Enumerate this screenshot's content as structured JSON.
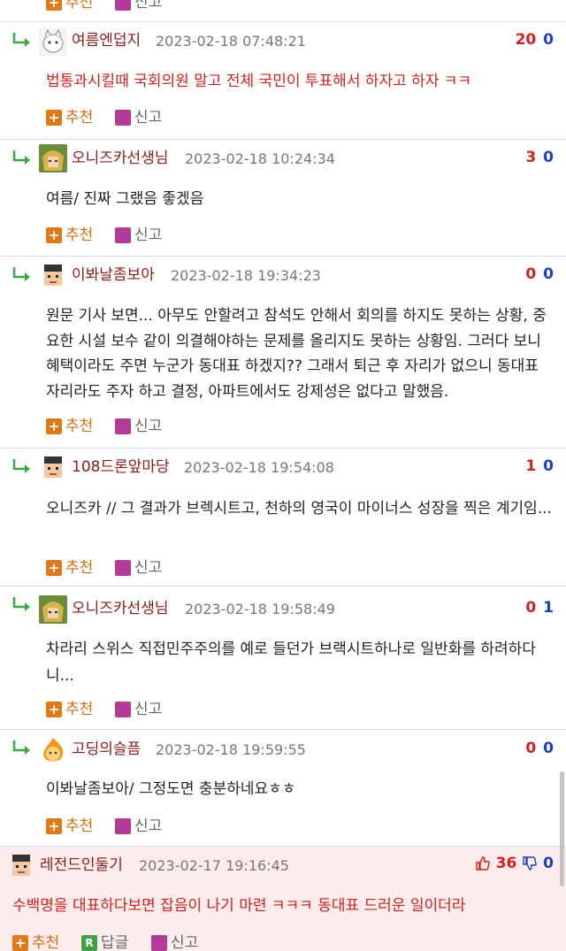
{
  "actions": {
    "recommend": "추천",
    "report": "신고",
    "reply": "답글"
  },
  "top_partial": {
    "recommend": "추천",
    "report": "신고"
  },
  "comments": [
    {
      "nick": "여름엔덥지",
      "date": "2023-02-18 07:48:21",
      "up": "20",
      "down": "0",
      "text": "법통과시킬때 국회의원 말고 전체 국민이 투표해서 하자고 하자 ㅋㅋ",
      "avatar": "cat-avatar"
    },
    {
      "nick": "오니즈카선생님",
      "date": "2023-02-18 10:24:34",
      "up": "3",
      "down": "0",
      "text": "여름/ 진짜 그랬음 좋겠음",
      "avatar": "anime-avatar"
    },
    {
      "nick": "이봐날좀보아",
      "date": "2023-02-18 19:34:23",
      "up": "0",
      "down": "0",
      "text": "원문 기사 보면... 아무도 안할려고 참석도 안해서 회의를 하지도 못하는 상황, 중요한 시설 보수 같이 의결해야하는 문제를 올리지도 못하는 상황임. 그러다 보니 혜택이라도 주면 누군가 동대표 하겠지?? 그래서 퇴근 후 자리가 없으니 동대표 자리라도 주자 하고 결정, 아파트에서도 강제성은 없다고 말했음.",
      "avatar": "pixel-avatar"
    },
    {
      "nick": "108드론앞마당",
      "date": "2023-02-18 19:54:08",
      "up": "1",
      "down": "0",
      "text": "오니즈카 // 그 결과가 브렉시트고, 천하의 영국이 마이너스 성장을 찍은 계기임...",
      "avatar": "pixel-avatar"
    },
    {
      "nick": "오니즈카선생님",
      "date": "2023-02-18 19:58:49",
      "up": "0",
      "down": "1",
      "text": "차라리 스위스 직접민주주의를 예로 들던가 브랙시트하나로 일반화를 하려하다니...",
      "avatar": "anime-avatar"
    },
    {
      "nick": "고딩의슬픔",
      "date": "2023-02-18 19:59:55",
      "up": "0",
      "down": "0",
      "text": "이봐날좀보아/ 그정도면 충분하네요ㅎㅎ",
      "avatar": "flame-avatar"
    }
  ],
  "best_comment": {
    "nick": "레전드인둘기",
    "date": "2023-02-17 19:16:45",
    "up": "36",
    "down": "0",
    "text": "수백명을 대표하다보면 잡음이 나기 마련 ㅋㅋㅋ 동대표 드러운 일이더라",
    "avatar": "pixel-avatar"
  },
  "colors": {
    "nick": "#8a1b1b",
    "upvote": "#d21f1f",
    "downvote": "#1b3fbf",
    "recommend": "#d26b0a",
    "best_bg": "#fdecec",
    "reply_arrow": "#3aa845"
  }
}
